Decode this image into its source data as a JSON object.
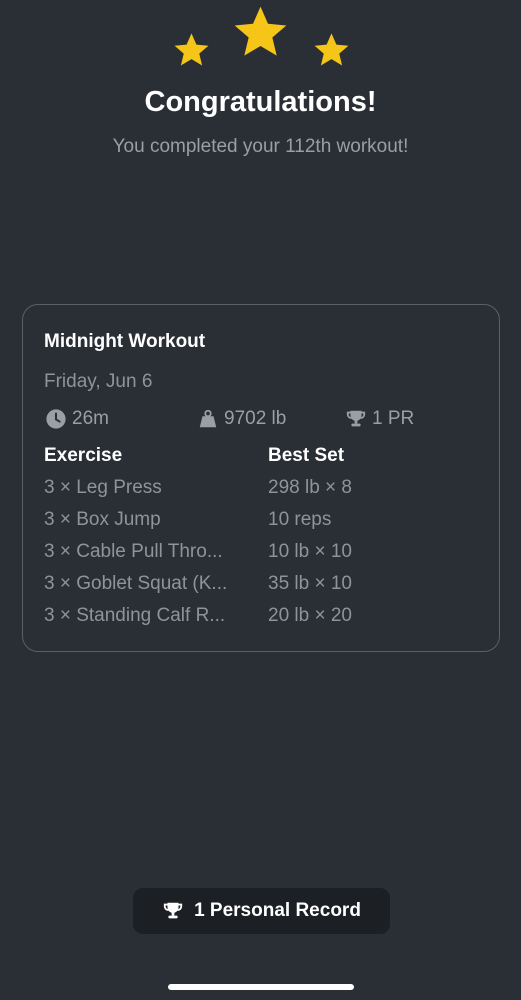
{
  "colors": {
    "background": "#2a2e35",
    "star": "#f5c518",
    "muted_text": "#8f939b",
    "card_border": "#5a5f68",
    "pill_background": "#1c1f24"
  },
  "header": {
    "title": "Congratulations!",
    "subtitle": "You completed your 112th workout!"
  },
  "workout": {
    "name": "Midnight Workout",
    "date": "Friday, Jun 6",
    "stats": {
      "duration": "26m",
      "volume": "9702 lb",
      "prs": "1 PR"
    },
    "table": {
      "headers": {
        "exercise": "Exercise",
        "best_set": "Best Set"
      },
      "rows": [
        {
          "exercise": "3 × Leg Press",
          "best_set": "298 lb × 8"
        },
        {
          "exercise": "3 × Box Jump",
          "best_set": "10 reps"
        },
        {
          "exercise": "3 × Cable Pull Thro...",
          "best_set": "10 lb × 10"
        },
        {
          "exercise": "3 × Goblet Squat (K...",
          "best_set": "35 lb × 10"
        },
        {
          "exercise": "3 × Standing Calf R...",
          "best_set": "20 lb × 20"
        }
      ]
    }
  },
  "footer": {
    "personal_record_label": "1 Personal Record"
  },
  "icons": {
    "stars": "star-icon",
    "duration": "clock-icon",
    "volume": "weight-icon",
    "prs": "trophy-icon"
  }
}
